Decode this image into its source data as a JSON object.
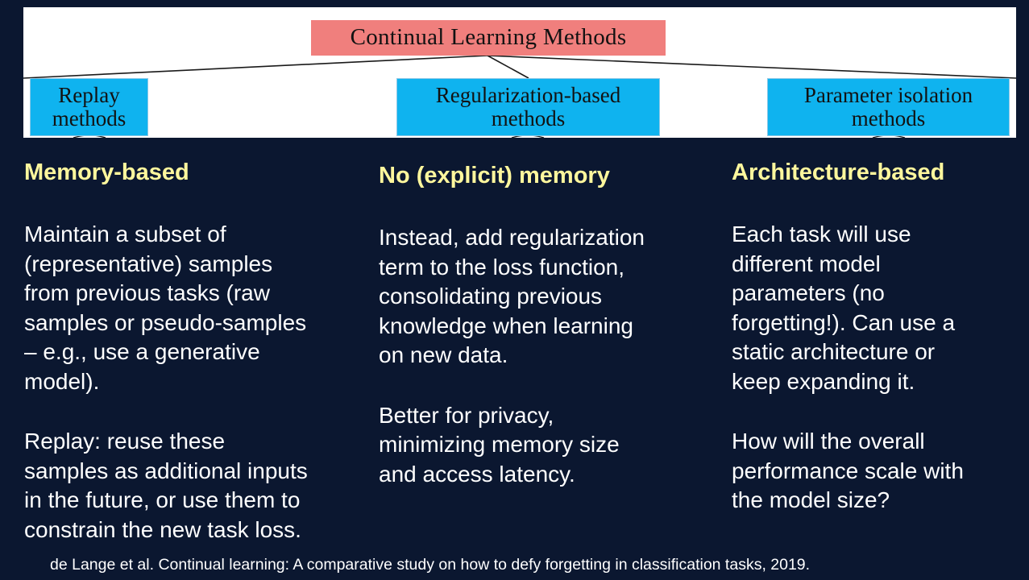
{
  "diagram": {
    "root_label": "Continual Learning Methods",
    "categories": [
      {
        "line1": "Replay",
        "line2": "methods"
      },
      {
        "line1": "Regularization-based",
        "line2": "methods"
      },
      {
        "line1": "Parameter isolation",
        "line2": "methods"
      }
    ],
    "colors": {
      "root_fill": "#f07f7d",
      "category_fill": "#0fb3ef",
      "panel_fill": "#ffffff",
      "line": "#1a1a1a"
    }
  },
  "columns": [
    {
      "heading": "Memory-based",
      "paragraphs": [
        "Maintain a subset of\n(representative) samples\nfrom previous tasks  (raw\nsamples or pseudo-samples\n– e.g., use a generative\nmodel).",
        "Replay:   reuse these\nsamples as additional inputs\nin the future, or use them to\nconstrain the new task loss."
      ]
    },
    {
      "heading": "No (explicit) memory",
      "paragraphs": [
        "Instead, add regularization\nterm to the loss function,\nconsolidating previous\nknowledge when learning\non new data.",
        "Better for privacy,\nminimizing memory size\nand access latency."
      ]
    },
    {
      "heading": "Architecture-based",
      "paragraphs": [
        "Each task will use\ndifferent model\nparameters (no\nforgetting!).  Can use a\nstatic architecture or\nkeep expanding  it.",
        "How will the overall\nperformance scale with\nthe model size?"
      ]
    }
  ],
  "citation": "de Lange et al. Continual learning: A comparative study on how to defy forgetting in classification tasks, 2019.",
  "theme": {
    "background": "#0b1730",
    "heading_color": "#fff79d",
    "text_color": "#ffffff"
  }
}
